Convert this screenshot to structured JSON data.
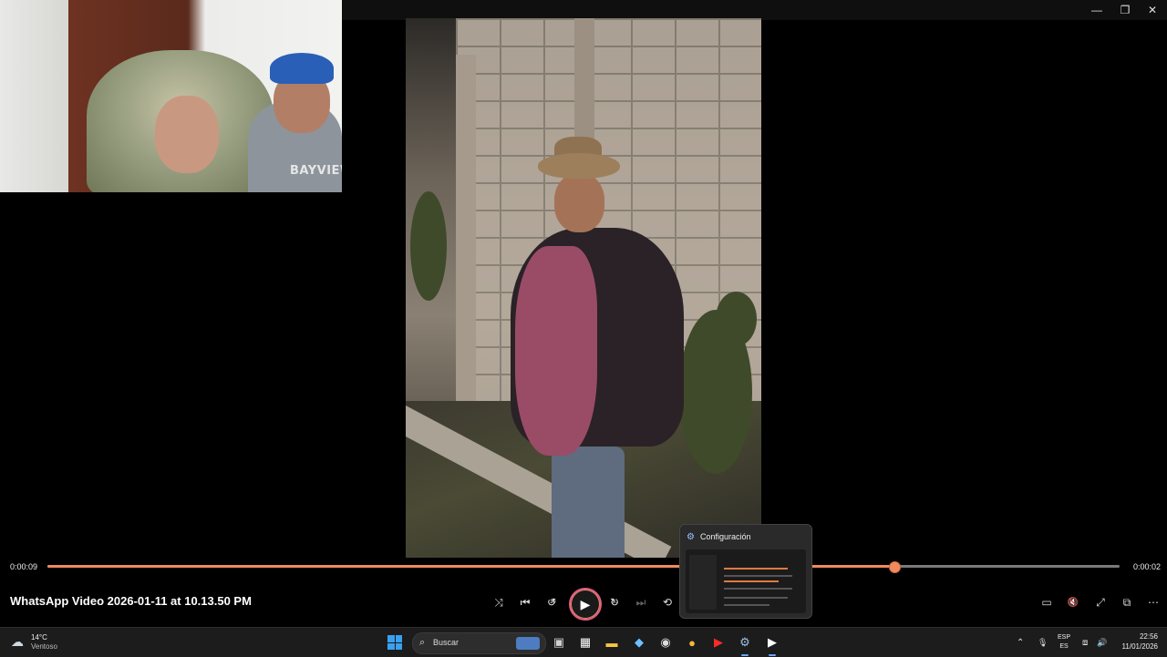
{
  "window": {
    "controls": {
      "minimize_icon": "—",
      "restore_icon": "❐",
      "close_icon": "✕"
    }
  },
  "webcam": {
    "shirt_text": "BAYVIEW"
  },
  "player": {
    "elapsed": "0:00:09",
    "remaining": "0:00:02",
    "progress_percent": 79,
    "title": "WhatsApp Video 2026-01-11 at 10.13.50 PM",
    "controls": {
      "shuffle": "⤨",
      "previous": "⏮",
      "rewind": "↺",
      "rewind_seconds": "10",
      "play": "▶",
      "forward": "↻",
      "forward_seconds": "30",
      "next": "⏭",
      "repeat": "⟲",
      "miniplayer": "▭",
      "mute": "🔇",
      "fullscreen": "⤢",
      "cast": "⧉",
      "more": "⋯"
    },
    "accent_color": "#f08a5d"
  },
  "popup": {
    "title": "Configuración",
    "icon": "⚙"
  },
  "taskbar": {
    "weather": {
      "temp": "14°C",
      "condition": "Ventoso",
      "icon": "☁"
    },
    "search_placeholder": "Buscar",
    "search_icon": "⌕",
    "apps": [
      {
        "name": "task-view",
        "glyph": "▣",
        "color": "#cfcfcf"
      },
      {
        "name": "store",
        "glyph": "▦",
        "color": "#ffffff"
      },
      {
        "name": "file-explorer",
        "glyph": "▬",
        "color": "#f5c542"
      },
      {
        "name": "copilot",
        "glyph": "◆",
        "color": "#6bc1ff"
      },
      {
        "name": "obs",
        "glyph": "◉",
        "color": "#dddddd"
      },
      {
        "name": "chrome",
        "glyph": "●",
        "color": "#f2b83a"
      },
      {
        "name": "youtube",
        "glyph": "▶",
        "color": "#ff2a2a"
      },
      {
        "name": "settings",
        "glyph": "⚙",
        "color": "#9fbfe6"
      },
      {
        "name": "media-player",
        "glyph": "▶",
        "color": "#ffffff"
      }
    ],
    "tray": {
      "chevron": "⌃",
      "mic": "🎙",
      "lang_top": "ESP",
      "lang_bottom": "ES",
      "network": "⧈",
      "volume": "🔊"
    },
    "time": "22:56",
    "date": "11/01/2026"
  }
}
